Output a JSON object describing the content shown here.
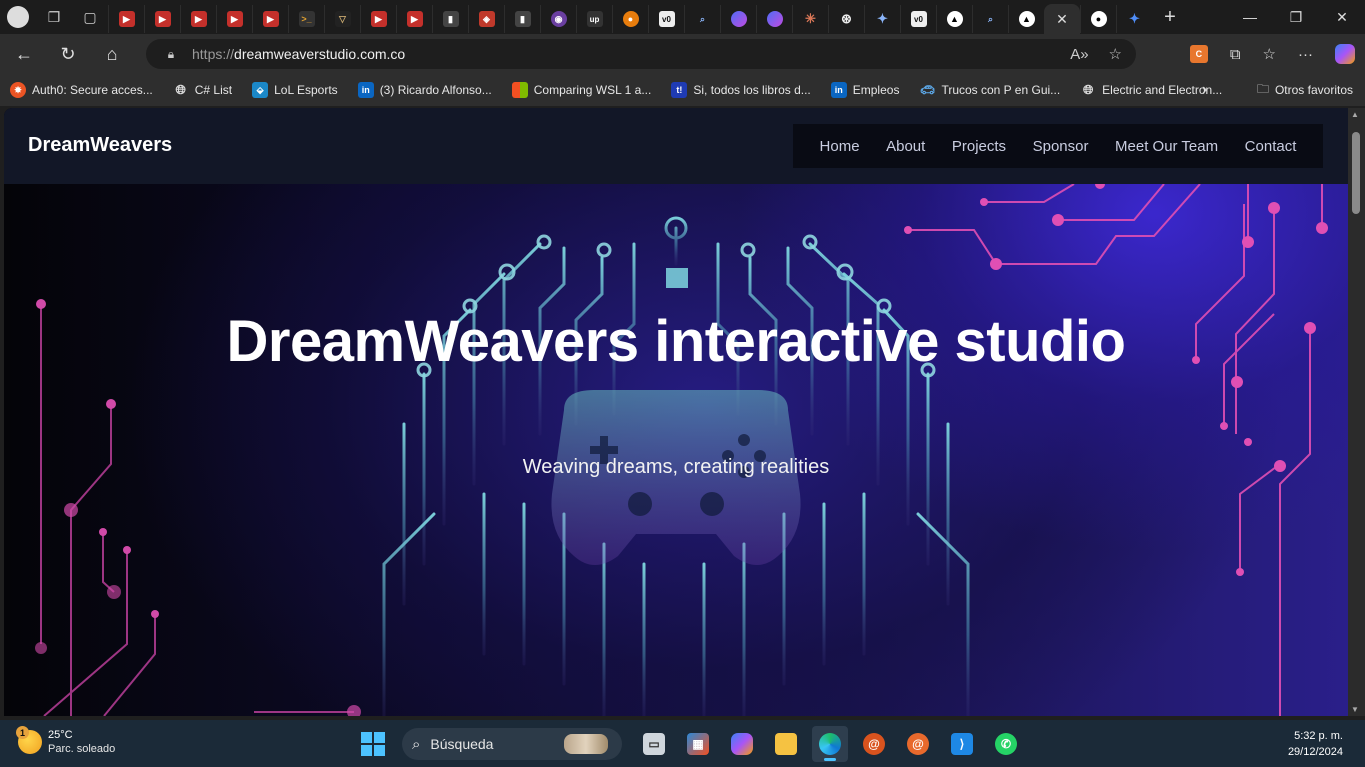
{
  "browser": {
    "address_bar": {
      "scheme": "https://",
      "host": "dreamweaverstudio.com.co"
    },
    "bookmarks": [
      {
        "label": "Auth0: Secure acces...",
        "icon": "auth0-icon"
      },
      {
        "label": "C# List",
        "icon": "globe-icon"
      },
      {
        "label": "LoL Esports",
        "icon": "lol-esports-icon"
      },
      {
        "label": "(3) Ricardo Alfonso...",
        "icon": "linkedin-icon"
      },
      {
        "label": "Comparing WSL 1 a...",
        "icon": "microsoft-icon"
      },
      {
        "label": "Si, todos los libros d...",
        "icon": "taringa-icon"
      },
      {
        "label": "Empleos",
        "icon": "linkedin-icon"
      },
      {
        "label": "Trucos con P en Gui...",
        "icon": "car-icon"
      },
      {
        "label": "Electric and Electron...",
        "icon": "globe-icon"
      }
    ],
    "other_favorites": "Otros favoritos"
  },
  "site": {
    "brand": "DreamWeavers",
    "nav": [
      "Home",
      "About",
      "Projects",
      "Sponsor",
      "Meet Our Team",
      "Contact"
    ],
    "hero": {
      "title": "DreamWeavers interactive studio",
      "subtitle": "Weaving dreams, creating realities"
    }
  },
  "taskbar": {
    "weather": {
      "badge": "1",
      "temp": "25°C",
      "condition": "Parc. soleado"
    },
    "search_placeholder": "Búsqueda",
    "clock": {
      "time": "5:32 p. m.",
      "date": "29/12/2024"
    }
  },
  "colors": {
    "accent": "#4cc2ff",
    "hero_pink": "#e04fb4",
    "hero_teal": "#6fd0d8"
  }
}
